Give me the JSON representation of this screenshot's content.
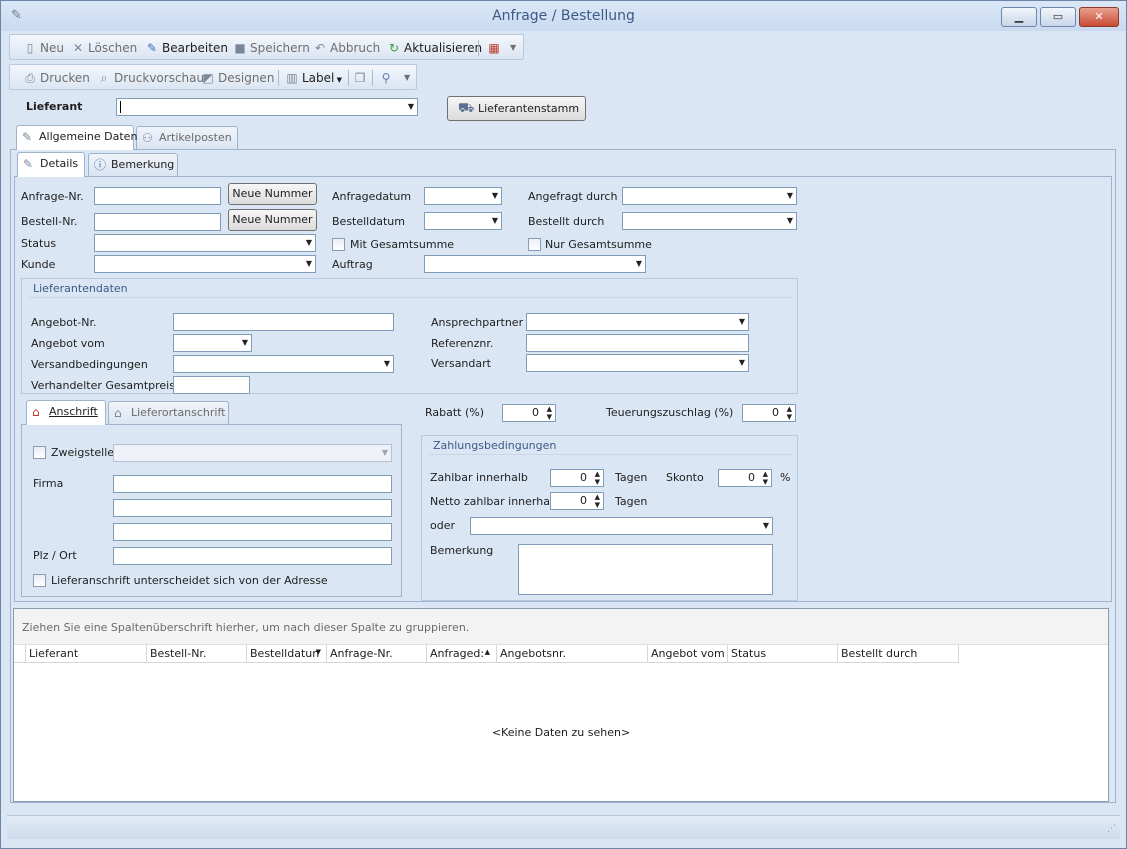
{
  "window": {
    "title": "Anfrage / Bestellung"
  },
  "toolbar1": {
    "neu": "Neu",
    "loeschen": "Löschen",
    "bearbeiten": "Bearbeiten",
    "speichern": "Speichern",
    "abbruch": "Abbruch",
    "aktualisieren": "Aktualisieren"
  },
  "toolbar2": {
    "drucken": "Drucken",
    "druckvorschau": "Druckvorschau",
    "designen": "Designen",
    "label": "Label"
  },
  "lieferant": {
    "label": "Lieferant",
    "value": "",
    "stamm_button": "Lieferantenstamm"
  },
  "main_tabs": [
    "Allgemeine Daten",
    "Artikelposten"
  ],
  "sub_tabs": [
    "Details",
    "Bemerkung"
  ],
  "details": {
    "anfrage_nr_label": "Anfrage-Nr.",
    "anfrage_nr": "",
    "bestell_nr_label": "Bestell-Nr.",
    "bestell_nr": "",
    "neue_nummer": "Neue Nummer",
    "status_label": "Status",
    "kunde_label": "Kunde",
    "anfragedatum_label": "Anfragedatum",
    "bestelldatum_label": "Bestelldatum",
    "mit_gesamtsumme": "Mit Gesamtsumme",
    "auftrag_label": "Auftrag",
    "angefragt_durch_label": "Angefragt durch",
    "bestellt_durch_label": "Bestellt durch",
    "nur_gesamtsumme": "Nur Gesamtsumme"
  },
  "lieferantendaten": {
    "title": "Lieferantendaten",
    "angebot_nr": "Angebot-Nr.",
    "angebot_vom": "Angebot vom",
    "versandbedingungen": "Versandbedingungen",
    "verhandelter_gesamtpreis": "Verhandelter Gesamtpreis",
    "ansprechpartner": "Ansprechpartner",
    "referenznr": "Referenznr.",
    "versandart": "Versandart"
  },
  "address_tabs": [
    "Anschrift",
    "Lieferortanschrift"
  ],
  "anschrift": {
    "zweigstelle": "Zweigstelle",
    "firma": "Firma",
    "plz_ort": "Plz / Ort",
    "lieferanschrift_check": "Lieferanschrift unterscheidet sich von der Adresse"
  },
  "rabatt": {
    "label": "Rabatt (%)",
    "value": "0"
  },
  "teuerung": {
    "label": "Teuerungszuschlag (%)",
    "value": "0"
  },
  "zahlung": {
    "title": "Zahlungsbedingungen",
    "zahlbar_innerhalb": "Zahlbar innerhalb",
    "zahlbar_value": "0",
    "tagen": "Tagen",
    "skonto": "Skonto",
    "skonto_value": "0",
    "percent": "%",
    "netto_zahlbar": "Netto zahlbar innerhalb",
    "netto_value": "0",
    "oder": "oder",
    "bemerkung": "Bemerkung"
  },
  "grid": {
    "group_hint": "Ziehen Sie eine Spaltenüberschrift hierher, um nach dieser Spalte zu gruppieren.",
    "columns": [
      "Lieferant",
      "Bestell-Nr.",
      "Bestelldatun",
      "Anfrage-Nr.",
      "Anfraged:",
      "Angebotsnr.",
      "Angebot vom",
      "Status",
      "Bestellt durch"
    ],
    "empty": "<Keine Daten zu sehen>"
  }
}
